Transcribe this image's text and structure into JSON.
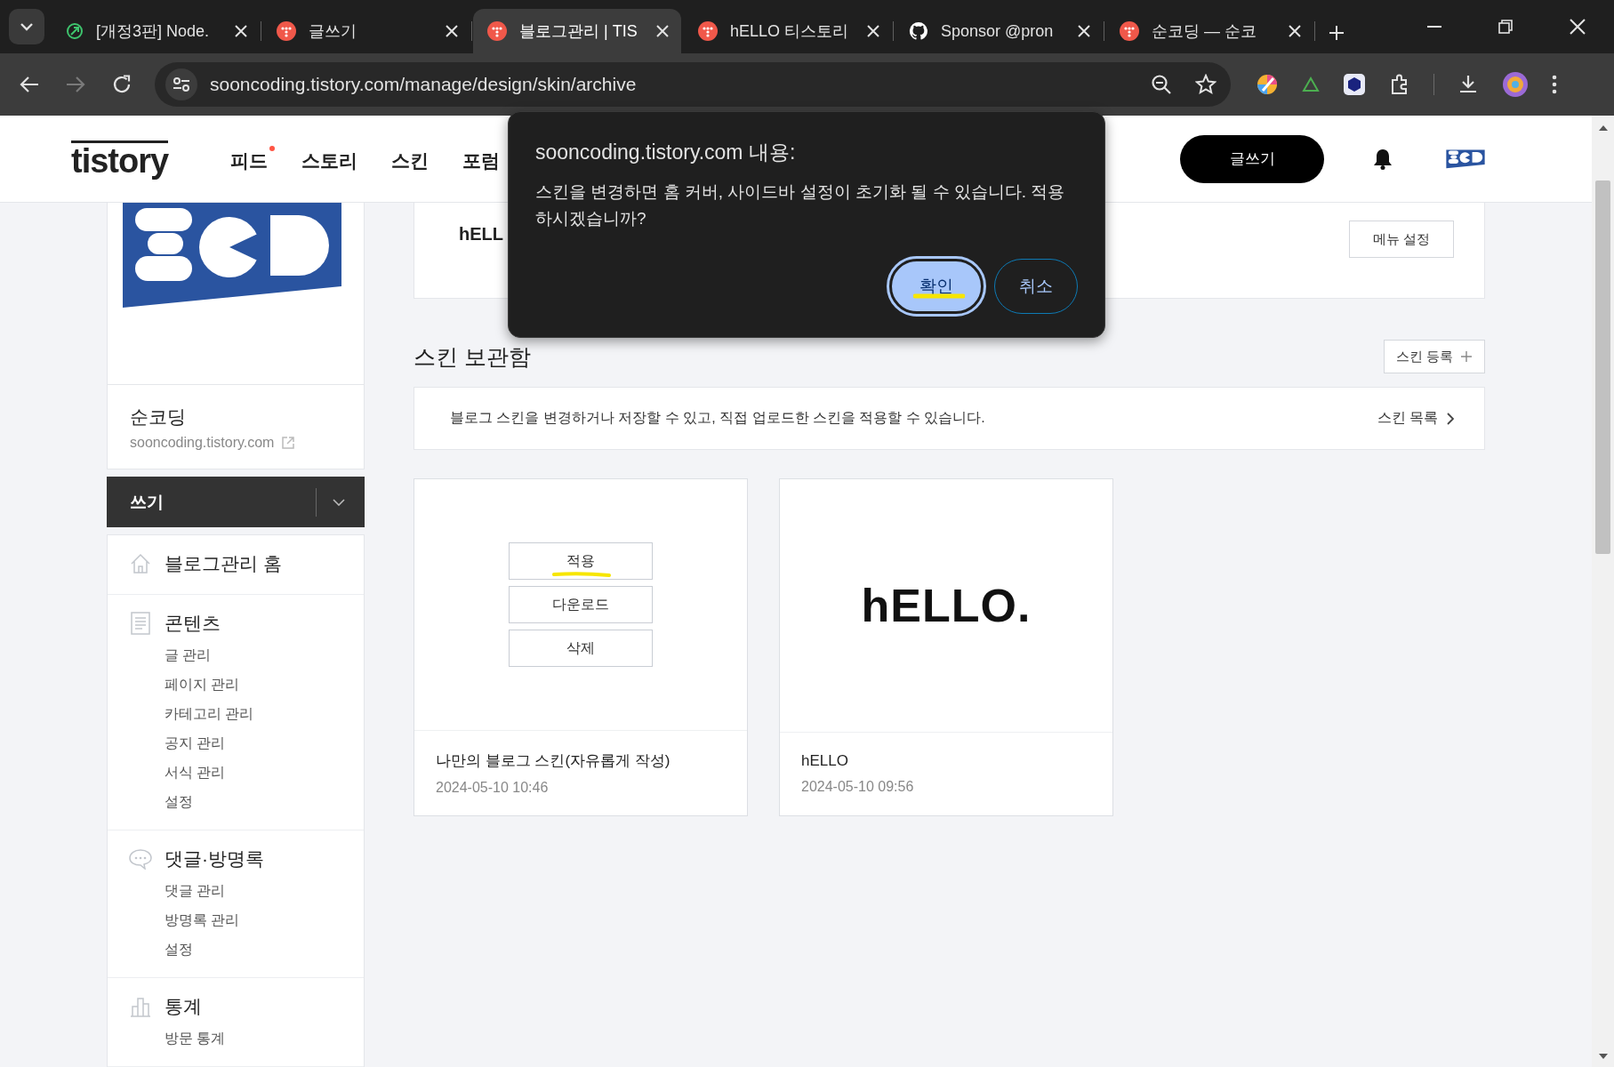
{
  "browser": {
    "tabs": [
      {
        "title": "[개정3판] Node.",
        "kind": "node",
        "selected": false
      },
      {
        "title": "글쓰기",
        "kind": "tistory",
        "selected": false
      },
      {
        "title": "블로그관리 | TIS",
        "kind": "tistory",
        "selected": true
      },
      {
        "title": "hELLO 티스토리",
        "kind": "tistory",
        "selected": false
      },
      {
        "title": "Sponsor @pron",
        "kind": "github",
        "selected": false
      },
      {
        "title": "순코딩 — 순코",
        "kind": "tistory",
        "selected": false
      }
    ],
    "can_go_forward": false,
    "url": "sooncoding.tistory.com/manage/design/skin/archive"
  },
  "header": {
    "logo": "tistory",
    "nav": [
      {
        "label": "피드",
        "dot": true
      },
      {
        "label": "스토리",
        "dot": false
      },
      {
        "label": "스킨",
        "dot": false
      },
      {
        "label": "포럼",
        "dot": false
      }
    ],
    "write_button": "글쓰기"
  },
  "sidebar": {
    "blog_name": "순코딩",
    "blog_url": "sooncoding.tistory.com",
    "write_button": "쓰기",
    "sections": [
      {
        "kind": "home",
        "title": "블로그관리 홈"
      },
      {
        "kind": "document",
        "title": "콘텐츠",
        "items": [
          "글 관리",
          "페이지 관리",
          "카테고리 관리",
          "공지 관리",
          "서식 관리",
          "설정"
        ]
      },
      {
        "kind": "comment",
        "title": "댓글·방명록",
        "items": [
          "댓글 관리",
          "방명록 관리",
          "설정"
        ]
      },
      {
        "kind": "chart",
        "title": "통계",
        "items": [
          "방문 통계"
        ]
      }
    ]
  },
  "main": {
    "blog_card": {
      "title": "hELL",
      "button": "메뉴 설정"
    },
    "archive": {
      "title": "스킨 보관함",
      "register_button": "스킨 등록",
      "info": "블로그 스킨을 변경하거나 저장할 수 있고, 직접 업로드한 스킨을 적용할 수 있습니다.",
      "list_link": "스킨 목록",
      "skins": [
        {
          "kind": "actions",
          "actions": [
            {
              "label": "적용",
              "highlighted": true
            },
            {
              "label": "다운로드",
              "highlighted": false
            },
            {
              "label": "삭제",
              "highlighted": false
            }
          ],
          "name": "나만의 블로그 스킨(자유롭게 작성)",
          "date": "2024-05-10 10:46"
        },
        {
          "kind": "preview",
          "preview_text": "hELLO.",
          "name": "hELLO",
          "date": "2024-05-10 09:56"
        }
      ]
    }
  },
  "dialog": {
    "title": "sooncoding.tistory.com 내용:",
    "message": "스킨을 변경하면 홈 커버, 사이드바 설정이 초기화 될 수 있습니다. 적용하시겠습니까?",
    "buttons": [
      {
        "label": "확인",
        "focused": true,
        "highlighted": true
      },
      {
        "label": "취소",
        "focused": false,
        "highlighted": false
      }
    ]
  }
}
